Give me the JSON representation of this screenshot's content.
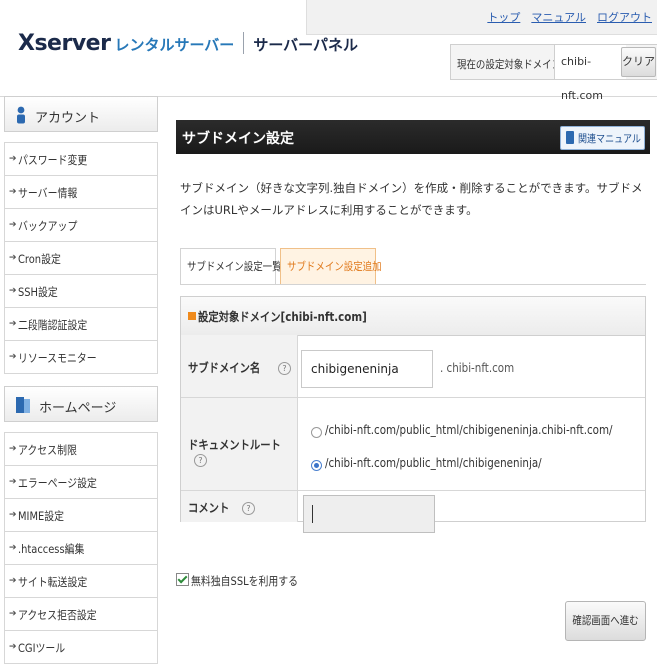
{
  "header": {
    "brand": "Xserver",
    "brand_sub": "レンタルサーバー",
    "panel": "サーバーパネル",
    "topnav": [
      "トップ",
      "マニュアル",
      "ログアウト"
    ],
    "domain_label": "現在の設定対象ドメイン",
    "domain_value": "chibi-nft.com",
    "clear_label": "クリア"
  },
  "sidebar": {
    "account": {
      "title": "アカウント",
      "icon": "person-icon",
      "items": [
        "パスワード変更",
        "サーバー情報",
        "バックアップ",
        "Cron設定",
        "SSH設定",
        "二段階認証設定",
        "リソースモニター"
      ]
    },
    "homepage": {
      "title": "ホームページ",
      "icon": "homepage-icon",
      "items": [
        "アクセス制限",
        "エラーページ設定",
        "MIME設定",
        ".htaccess編集",
        "サイト転送設定",
        "アクセス拒否設定",
        "CGIツール"
      ]
    }
  },
  "main": {
    "title": "サブドメイン設定",
    "manual_label": "関連マニュアル",
    "description": "サブドメイン（好きな文字列.独自ドメイン）を作成・削除することができます。サブドメインはURLやメールアドレスに利用することができます。",
    "tabs": [
      {
        "label": "サブドメイン設定一覧",
        "active": false
      },
      {
        "label": "サブドメイン設定追加",
        "active": true
      }
    ],
    "form": {
      "heading": "設定対象ドメイン[chibi-nft.com]",
      "subdomain_label": "サブドメイン名",
      "subdomain_value": "chibigeneninja",
      "subdomain_suffix": ". chibi-nft.com",
      "docroot_label": "ドキュメントルート",
      "docroot_options": [
        "/chibi-nft.com/public_html/chibigeneninja.chibi-nft.com/",
        "/chibi-nft.com/public_html/chibigeneninja/"
      ],
      "docroot_selected": 1,
      "comment_label": "コメント",
      "comment_value": "",
      "help_mark": "?"
    },
    "ssl_label": "無料独自SSLを利用する",
    "ssl_checked": true,
    "confirm_label": "確認画面へ進む"
  },
  "colors": {
    "accent_orange": "#e0791b",
    "title_bar": "#1a1a1a",
    "link_blue": "#2a5db0"
  }
}
